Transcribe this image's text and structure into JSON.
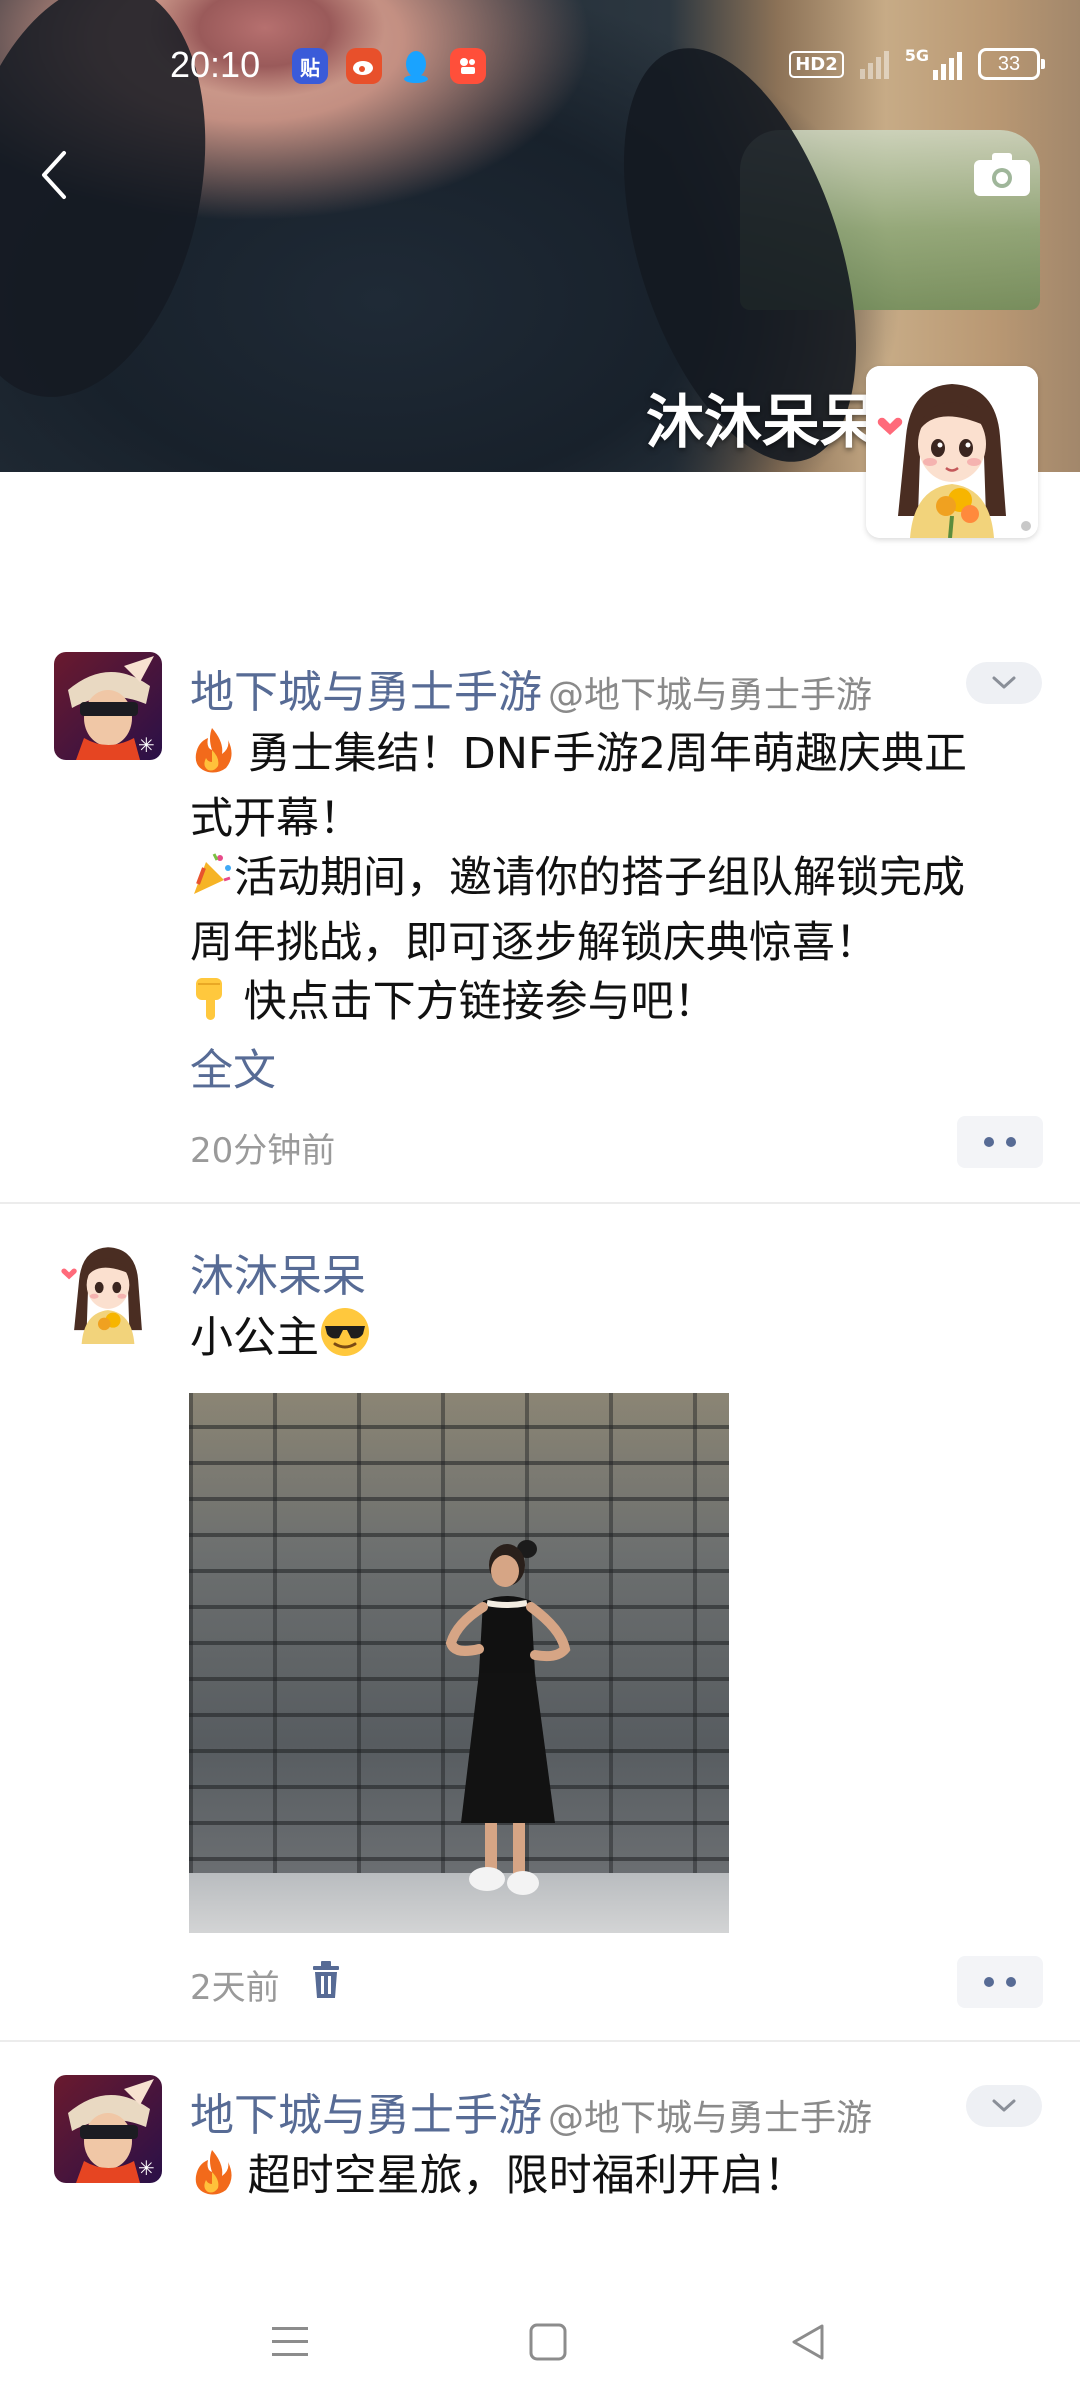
{
  "status_bar": {
    "time": "20:10",
    "apps": [
      {
        "icon": "tieba-icon",
        "glyph": "贴",
        "color": "#3a5bd9"
      },
      {
        "icon": "weibo-icon",
        "glyph": "",
        "color": "#e8502b"
      },
      {
        "icon": "qq-icon",
        "glyph": "",
        "color": "#1aa3ff"
      },
      {
        "icon": "kuaishou-icon",
        "glyph": "",
        "color": "#ff4f3a"
      }
    ],
    "hd_label": "HD2",
    "network": "5G",
    "battery": "33"
  },
  "cover": {
    "display_name": "沐沐呆呆",
    "back_icon": "back-arrow-icon",
    "camera_icon": "camera-icon"
  },
  "posts": [
    {
      "author": "地下城与勇士手游",
      "handle": "@地下城与勇士手游",
      "lines": [
        "勇士集结！DNF手游2周年萌趣庆典正",
        "式开幕！",
        "活动期间，邀请你的搭子组队解锁完成",
        "周年挑战，即可逐步解锁庆典惊喜！",
        "快点击下方链接参与吧！"
      ],
      "full_text_link": "全文",
      "time": "20分钟前"
    },
    {
      "author": "沐沐呆呆",
      "text": "小公主",
      "time": "2天前"
    },
    {
      "author": "地下城与勇士手游",
      "handle": "@地下城与勇士手游",
      "lines": [
        "超时空星旅，限时福利开启！"
      ]
    }
  ],
  "colors": {
    "link_blue": "#576b95",
    "time_gray": "#9a9a9a"
  }
}
